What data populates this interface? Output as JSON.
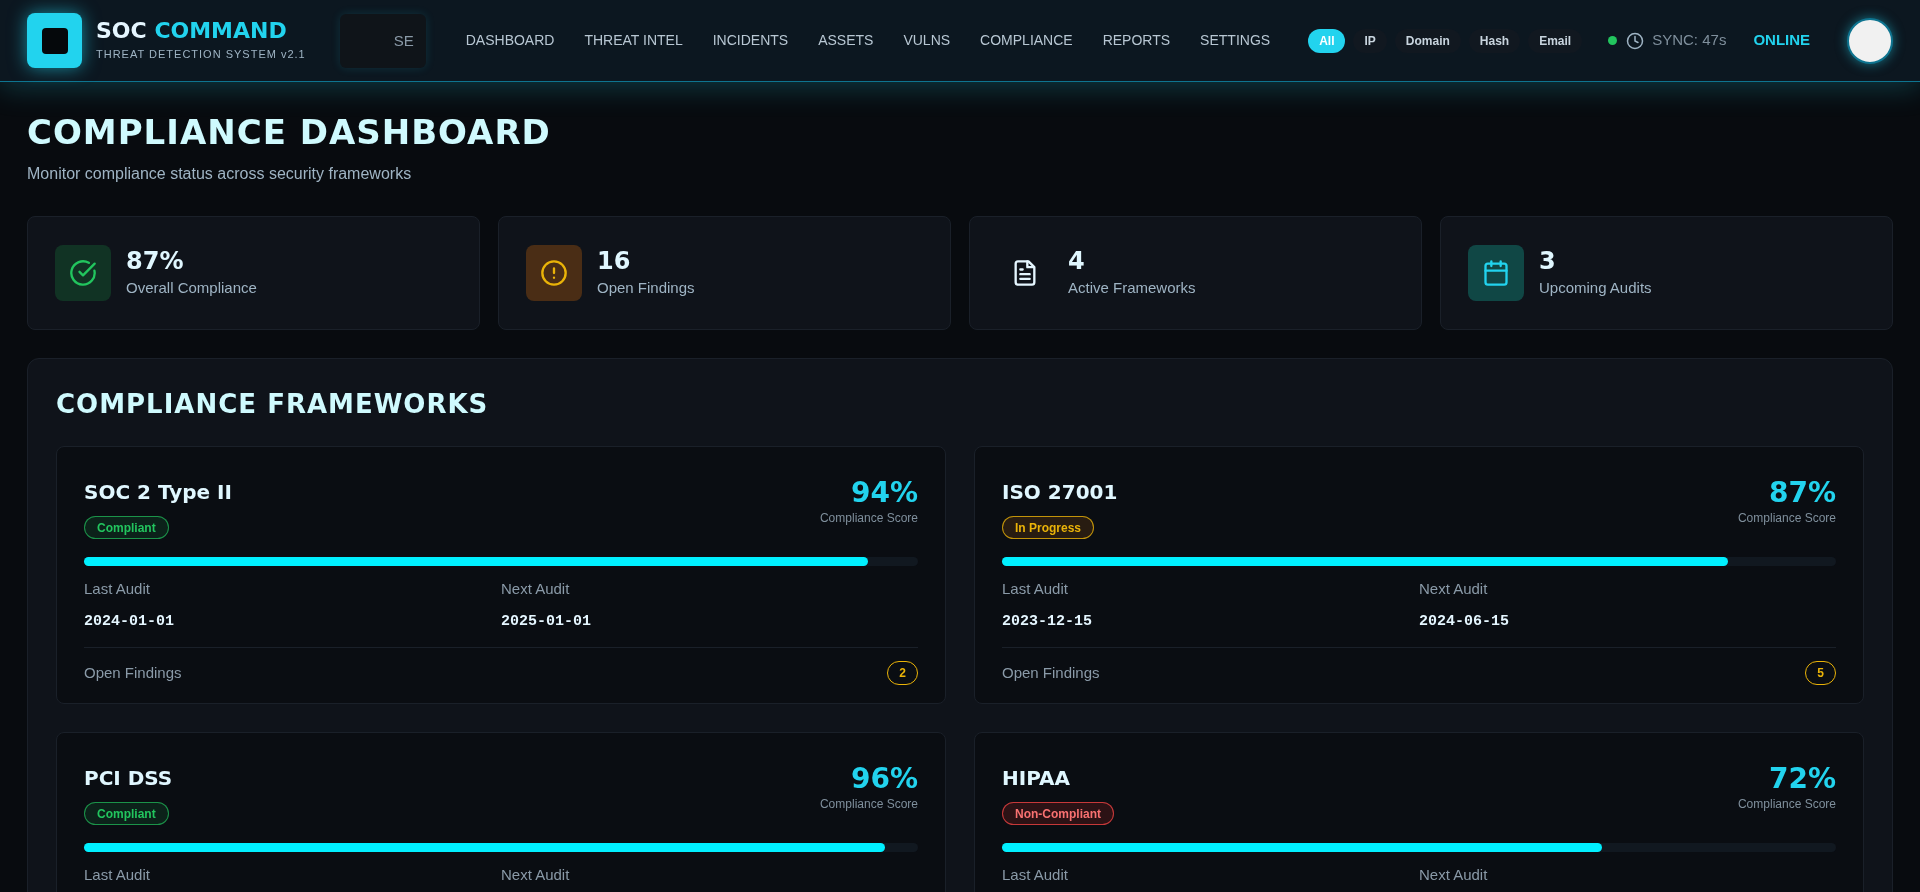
{
  "header": {
    "brand_main": "SOC",
    "brand_accent": "COMMAND",
    "subtitle": "THREAT DETECTION SYSTEM v2.1",
    "search": {
      "placeholder": "SE"
    },
    "nav": [
      {
        "label": "DASHBOARD",
        "selected": false
      },
      {
        "label": "THREAT INTEL",
        "selected": false
      },
      {
        "label": "INCIDENTS",
        "selected": false
      },
      {
        "label": "ASSETS",
        "selected": false
      },
      {
        "label": "VULNS",
        "selected": false
      },
      {
        "label": "COMPLIANCE",
        "selected": false
      },
      {
        "label": "REPORTS",
        "selected": false
      },
      {
        "label": "SETTINGS",
        "selected": false
      }
    ],
    "filters": [
      {
        "label": "All",
        "selected": true
      },
      {
        "label": "IP",
        "selected": false
      },
      {
        "label": "Domain",
        "selected": false
      },
      {
        "label": "Hash",
        "selected": false
      },
      {
        "label": "Email",
        "selected": false
      }
    ],
    "sync": "SYNC: 47s",
    "connection": "ONLINE"
  },
  "page": {
    "title": "COMPLIANCE DASHBOARD",
    "subtitle": "Monitor compliance status across security frameworks"
  },
  "stats": [
    {
      "kind": "check",
      "value": "87%",
      "label": "Overall Compliance"
    },
    {
      "kind": "alert",
      "value": "16",
      "label": "Open Findings"
    },
    {
      "kind": "document",
      "value": "4",
      "label": "Active Frameworks"
    },
    {
      "kind": "calendar",
      "value": "3",
      "label": "Upcoming Audits"
    }
  ],
  "frameworks": {
    "title": "COMPLIANCE FRAMEWORKS",
    "items": [
      {
        "name": "SOC 2 Type II",
        "status": "Compliant",
        "kind": "compliant",
        "score": "94%",
        "score_label": "Compliance Score",
        "level": 0.94,
        "last_audit_label": "Last Audit",
        "last_audit": "2024-01-01",
        "next_audit_label": "Next Audit",
        "next_audit": "2025-01-01",
        "findings_label": "Open Findings",
        "findings": "2"
      },
      {
        "name": "ISO 27001",
        "status": "In Progress",
        "kind": "in_progress",
        "score": "87%",
        "score_label": "Compliance Score",
        "level": 0.87,
        "last_audit_label": "Last Audit",
        "last_audit": "2023-12-15",
        "next_audit_label": "Next Audit",
        "next_audit": "2024-06-15",
        "findings_label": "Open Findings",
        "findings": "5"
      },
      {
        "name": "PCI DSS",
        "status": "Compliant",
        "kind": "compliant",
        "score": "96%",
        "score_label": "Compliance Score",
        "level": 0.96,
        "last_audit_label": "Last Audit",
        "next_audit_label": "Next Audit"
      },
      {
        "name": "HIPAA",
        "status": "Non-Compliant",
        "kind": "non_compliant",
        "score": "72%",
        "score_label": "Compliance Score",
        "level": 0.72,
        "last_audit_label": "Last Audit",
        "next_audit_label": "Next Audit"
      }
    ]
  }
}
